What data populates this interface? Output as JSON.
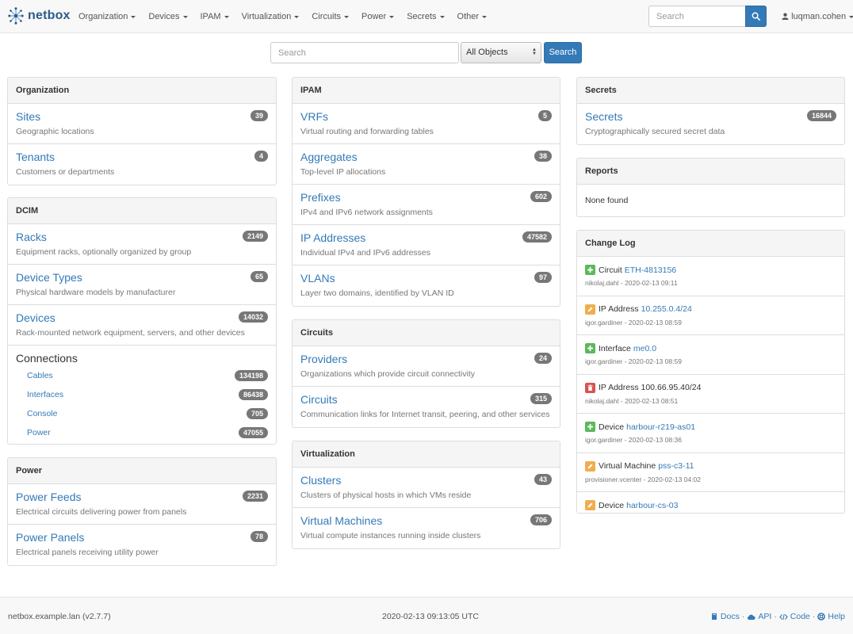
{
  "navbar": {
    "brand": "netbox",
    "menu": [
      {
        "label": "Organization"
      },
      {
        "label": "Devices"
      },
      {
        "label": "IPAM"
      },
      {
        "label": "Virtualization"
      },
      {
        "label": "Circuits"
      },
      {
        "label": "Power"
      },
      {
        "label": "Secrets"
      },
      {
        "label": "Other"
      }
    ],
    "search_placeholder": "Search",
    "user": "luqman.cohen"
  },
  "global_search": {
    "placeholder": "Search",
    "selected_object": "All Objects",
    "button": "Search"
  },
  "organization": {
    "heading": "Organization",
    "items": [
      {
        "title": "Sites",
        "desc": "Geographic locations",
        "count": "39"
      },
      {
        "title": "Tenants",
        "desc": "Customers or departments",
        "count": "4"
      }
    ]
  },
  "dcim": {
    "heading": "DCIM",
    "items": [
      {
        "title": "Racks",
        "desc": "Equipment racks, optionally organized by group",
        "count": "2149"
      },
      {
        "title": "Device Types",
        "desc": "Physical hardware models by manufacturer",
        "count": "65"
      },
      {
        "title": "Devices",
        "desc": "Rack-mounted network equipment, servers, and other devices",
        "count": "14032"
      }
    ],
    "connections": {
      "title": "Connections",
      "items": [
        {
          "label": "Cables",
          "count": "134198"
        },
        {
          "label": "Interfaces",
          "count": "86438"
        },
        {
          "label": "Console",
          "count": "705"
        },
        {
          "label": "Power",
          "count": "47055"
        }
      ]
    }
  },
  "power": {
    "heading": "Power",
    "items": [
      {
        "title": "Power Feeds",
        "desc": "Electrical circuits delivering power from panels",
        "count": "2231"
      },
      {
        "title": "Power Panels",
        "desc": "Electrical panels receiving utility power",
        "count": "78"
      }
    ]
  },
  "ipam": {
    "heading": "IPAM",
    "items": [
      {
        "title": "VRFs",
        "desc": "Virtual routing and forwarding tables",
        "count": "5"
      },
      {
        "title": "Aggregates",
        "desc": "Top-level IP allocations",
        "count": "38"
      },
      {
        "title": "Prefixes",
        "desc": "IPv4 and IPv6 network assignments",
        "count": "602"
      },
      {
        "title": "IP Addresses",
        "desc": "Individual IPv4 and IPv6 addresses",
        "count": "47582"
      },
      {
        "title": "VLANs",
        "desc": "Layer two domains, identified by VLAN ID",
        "count": "97"
      }
    ]
  },
  "circuits": {
    "heading": "Circuits",
    "items": [
      {
        "title": "Providers",
        "desc": "Organizations which provide circuit connectivity",
        "count": "24"
      },
      {
        "title": "Circuits",
        "desc": "Communication links for Internet transit, peering, and other services",
        "count": "315"
      }
    ]
  },
  "virtualization": {
    "heading": "Virtualization",
    "items": [
      {
        "title": "Clusters",
        "desc": "Clusters of physical hosts in which VMs reside",
        "count": "43"
      },
      {
        "title": "Virtual Machines",
        "desc": "Virtual compute instances running inside clusters",
        "count": "706"
      }
    ]
  },
  "secrets": {
    "heading": "Secrets",
    "items": [
      {
        "title": "Secrets",
        "desc": "Cryptographically secured secret data",
        "count": "16844"
      }
    ]
  },
  "reports": {
    "heading": "Reports",
    "empty": "None found"
  },
  "changelog": {
    "heading": "Change Log",
    "entries": [
      {
        "action": "create",
        "type": "Circuit",
        "object": "ETH-4813156",
        "meta": "nikolaj.dahl - 2020-02-13 09:11"
      },
      {
        "action": "update",
        "type": "IP Address",
        "object": "10.255.0.4/24",
        "meta": "igor.gardiner - 2020-02-13 08:59"
      },
      {
        "action": "create",
        "type": "Interface",
        "object": "me0.0",
        "meta": "igor.gardiner - 2020-02-13 08:59"
      },
      {
        "action": "delete",
        "type": "IP Address 100.66.95.40/24",
        "object": "",
        "meta": "nikolaj.dahl - 2020-02-13 08:51"
      },
      {
        "action": "create",
        "type": "Device",
        "object": "harbour-r219-as01",
        "meta": "igor.gardiner - 2020-02-13 08:36"
      },
      {
        "action": "update",
        "type": "Virtual Machine",
        "object": "pss-c3-11",
        "meta": "provisioner.vcenter - 2020-02-13 04:02"
      },
      {
        "action": "update",
        "type": "Device",
        "object": "harbour-cs-03",
        "meta": ""
      }
    ]
  },
  "footer": {
    "host": "netbox.example.lan (v2.7.7)",
    "timestamp": "2020-02-13 09:13:05 UTC",
    "links": {
      "docs": "Docs",
      "api": "API",
      "code": "Code",
      "help": "Help"
    },
    "sep": "·"
  },
  "colors": {
    "accent": "#337ab7",
    "badge": "#777777",
    "create": "#5cb85c",
    "update": "#f0ad4e",
    "delete": "#d9534f"
  }
}
